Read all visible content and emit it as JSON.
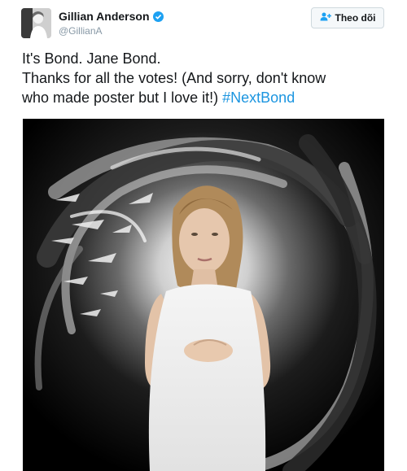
{
  "user": {
    "display_name": "Gillian Anderson",
    "handle": "@GillianA",
    "verified": true
  },
  "follow_button": {
    "label": "Theo dõi",
    "icon": "add-user-icon"
  },
  "tweet": {
    "line1": "It's Bond. Jane Bond.",
    "line2": "Thanks for all the votes! (And sorry, don't know",
    "line3": "who made poster but I love it!)",
    "hashtag": "#NextBond"
  },
  "colors": {
    "hashtag": "#1b95e0",
    "verified": "#1da1f2"
  }
}
